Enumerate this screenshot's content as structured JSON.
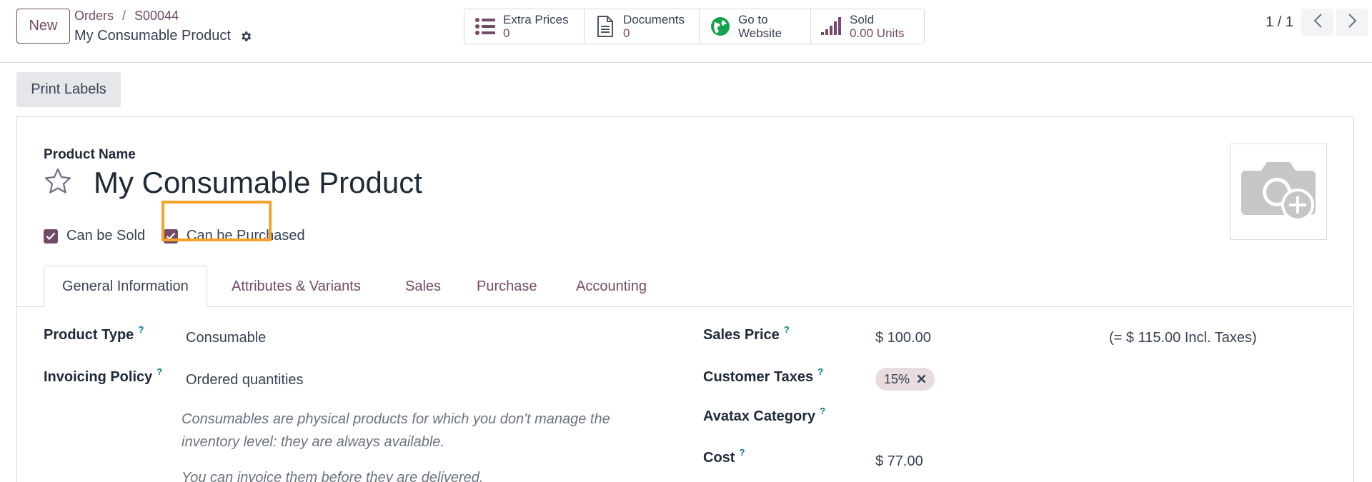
{
  "control_panel": {
    "new_label": "New",
    "breadcrumbs": [
      "Orders",
      "S00044"
    ],
    "breadcrumb_sep": "/",
    "record_title": "My Consumable Product",
    "smart_buttons": [
      {
        "label": "Extra Prices",
        "value": "0",
        "icon": "list-icon"
      },
      {
        "label": "Documents",
        "value": "0",
        "icon": "document-icon"
      },
      {
        "label": "Go to",
        "value": "Website",
        "icon": "globe-icon"
      },
      {
        "label": "Sold",
        "value": "0.00 Units",
        "icon": "bar-chart-icon"
      }
    ],
    "pager": "1 / 1"
  },
  "actions": {
    "print_labels": "Print Labels"
  },
  "form": {
    "product_name_label": "Product Name",
    "product_name": "My Consumable Product",
    "checkboxes": [
      {
        "label": "Can be Sold",
        "checked": true
      },
      {
        "label": "Can be Purchased",
        "checked": true
      }
    ],
    "tabs": [
      "General Information",
      "Attributes & Variants",
      "Sales",
      "Purchase",
      "Accounting"
    ],
    "active_tab": "General Information",
    "help_mark": "?",
    "left_fields": {
      "product_type_label": "Product Type",
      "product_type": "Consumable",
      "invoicing_policy_label": "Invoicing Policy",
      "invoicing_policy": "Ordered quantities",
      "help_text_1": "Consumables are physical products for which you don't manage the inventory level: they are always available.",
      "help_text_2": "You can invoice them before they are delivered."
    },
    "right_fields": {
      "sales_price_label": "Sales Price",
      "sales_price": "$ 100.00",
      "incl_taxes": "(= $ 115.00 Incl. Taxes)",
      "customer_taxes_label": "Customer Taxes",
      "customer_tax_tag": "15%",
      "avatax_label": "Avatax Category",
      "cost_label": "Cost",
      "cost": "$ 77.00"
    }
  },
  "colors": {
    "accent": "#714b67",
    "highlight": "#f6a225",
    "help": "#017e84"
  }
}
